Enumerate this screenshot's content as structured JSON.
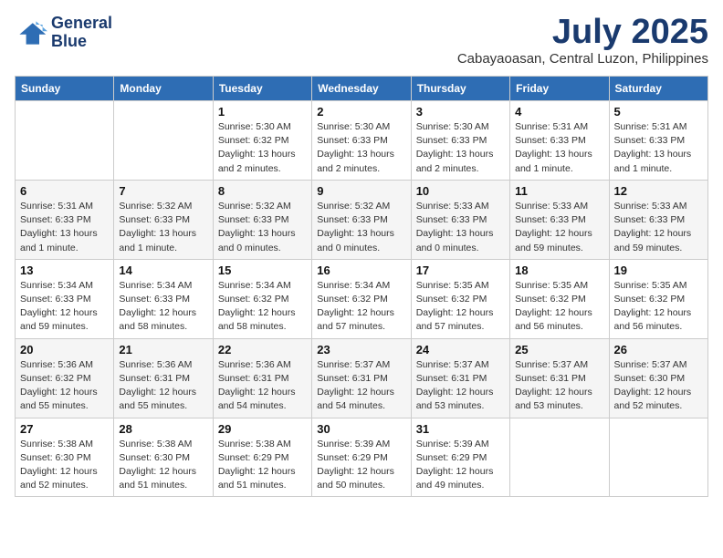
{
  "logo": {
    "line1": "General",
    "line2": "Blue"
  },
  "title": "July 2025",
  "location": "Cabayaoasan, Central Luzon, Philippines",
  "weekdays": [
    "Sunday",
    "Monday",
    "Tuesday",
    "Wednesday",
    "Thursday",
    "Friday",
    "Saturday"
  ],
  "weeks": [
    [
      {
        "day": "",
        "info": ""
      },
      {
        "day": "",
        "info": ""
      },
      {
        "day": "1",
        "info": "Sunrise: 5:30 AM\nSunset: 6:32 PM\nDaylight: 13 hours and 2 minutes."
      },
      {
        "day": "2",
        "info": "Sunrise: 5:30 AM\nSunset: 6:33 PM\nDaylight: 13 hours and 2 minutes."
      },
      {
        "day": "3",
        "info": "Sunrise: 5:30 AM\nSunset: 6:33 PM\nDaylight: 13 hours and 2 minutes."
      },
      {
        "day": "4",
        "info": "Sunrise: 5:31 AM\nSunset: 6:33 PM\nDaylight: 13 hours and 1 minute."
      },
      {
        "day": "5",
        "info": "Sunrise: 5:31 AM\nSunset: 6:33 PM\nDaylight: 13 hours and 1 minute."
      }
    ],
    [
      {
        "day": "6",
        "info": "Sunrise: 5:31 AM\nSunset: 6:33 PM\nDaylight: 13 hours and 1 minute."
      },
      {
        "day": "7",
        "info": "Sunrise: 5:32 AM\nSunset: 6:33 PM\nDaylight: 13 hours and 1 minute."
      },
      {
        "day": "8",
        "info": "Sunrise: 5:32 AM\nSunset: 6:33 PM\nDaylight: 13 hours and 0 minutes."
      },
      {
        "day": "9",
        "info": "Sunrise: 5:32 AM\nSunset: 6:33 PM\nDaylight: 13 hours and 0 minutes."
      },
      {
        "day": "10",
        "info": "Sunrise: 5:33 AM\nSunset: 6:33 PM\nDaylight: 13 hours and 0 minutes."
      },
      {
        "day": "11",
        "info": "Sunrise: 5:33 AM\nSunset: 6:33 PM\nDaylight: 12 hours and 59 minutes."
      },
      {
        "day": "12",
        "info": "Sunrise: 5:33 AM\nSunset: 6:33 PM\nDaylight: 12 hours and 59 minutes."
      }
    ],
    [
      {
        "day": "13",
        "info": "Sunrise: 5:34 AM\nSunset: 6:33 PM\nDaylight: 12 hours and 59 minutes."
      },
      {
        "day": "14",
        "info": "Sunrise: 5:34 AM\nSunset: 6:33 PM\nDaylight: 12 hours and 58 minutes."
      },
      {
        "day": "15",
        "info": "Sunrise: 5:34 AM\nSunset: 6:32 PM\nDaylight: 12 hours and 58 minutes."
      },
      {
        "day": "16",
        "info": "Sunrise: 5:34 AM\nSunset: 6:32 PM\nDaylight: 12 hours and 57 minutes."
      },
      {
        "day": "17",
        "info": "Sunrise: 5:35 AM\nSunset: 6:32 PM\nDaylight: 12 hours and 57 minutes."
      },
      {
        "day": "18",
        "info": "Sunrise: 5:35 AM\nSunset: 6:32 PM\nDaylight: 12 hours and 56 minutes."
      },
      {
        "day": "19",
        "info": "Sunrise: 5:35 AM\nSunset: 6:32 PM\nDaylight: 12 hours and 56 minutes."
      }
    ],
    [
      {
        "day": "20",
        "info": "Sunrise: 5:36 AM\nSunset: 6:32 PM\nDaylight: 12 hours and 55 minutes."
      },
      {
        "day": "21",
        "info": "Sunrise: 5:36 AM\nSunset: 6:31 PM\nDaylight: 12 hours and 55 minutes."
      },
      {
        "day": "22",
        "info": "Sunrise: 5:36 AM\nSunset: 6:31 PM\nDaylight: 12 hours and 54 minutes."
      },
      {
        "day": "23",
        "info": "Sunrise: 5:37 AM\nSunset: 6:31 PM\nDaylight: 12 hours and 54 minutes."
      },
      {
        "day": "24",
        "info": "Sunrise: 5:37 AM\nSunset: 6:31 PM\nDaylight: 12 hours and 53 minutes."
      },
      {
        "day": "25",
        "info": "Sunrise: 5:37 AM\nSunset: 6:31 PM\nDaylight: 12 hours and 53 minutes."
      },
      {
        "day": "26",
        "info": "Sunrise: 5:37 AM\nSunset: 6:30 PM\nDaylight: 12 hours and 52 minutes."
      }
    ],
    [
      {
        "day": "27",
        "info": "Sunrise: 5:38 AM\nSunset: 6:30 PM\nDaylight: 12 hours and 52 minutes."
      },
      {
        "day": "28",
        "info": "Sunrise: 5:38 AM\nSunset: 6:30 PM\nDaylight: 12 hours and 51 minutes."
      },
      {
        "day": "29",
        "info": "Sunrise: 5:38 AM\nSunset: 6:29 PM\nDaylight: 12 hours and 51 minutes."
      },
      {
        "day": "30",
        "info": "Sunrise: 5:39 AM\nSunset: 6:29 PM\nDaylight: 12 hours and 50 minutes."
      },
      {
        "day": "31",
        "info": "Sunrise: 5:39 AM\nSunset: 6:29 PM\nDaylight: 12 hours and 49 minutes."
      },
      {
        "day": "",
        "info": ""
      },
      {
        "day": "",
        "info": ""
      }
    ]
  ]
}
